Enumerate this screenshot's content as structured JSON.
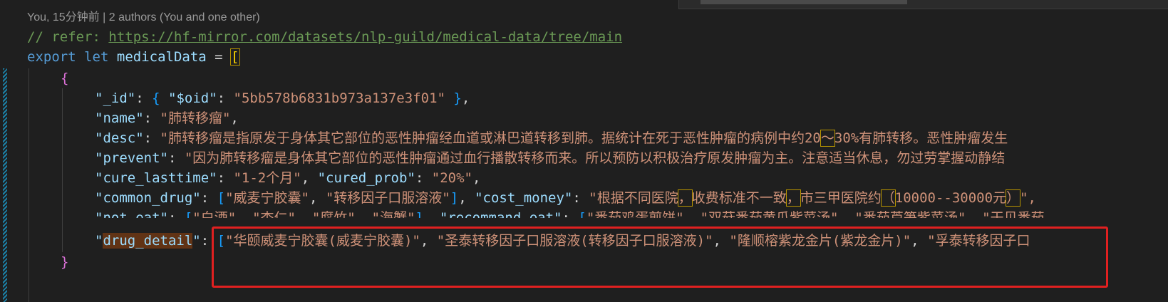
{
  "codelens": {
    "text": "You, 15分钟前 | 2 authors (You and one other)"
  },
  "code": {
    "comment_prefix": "// refer: ",
    "comment_url": "https://hf-mirror.com/datasets/nlp-guild/medical-data/tree/main",
    "export_kw": "export",
    "let_kw": "let",
    "var_name": "medicalData",
    "eq": " = ",
    "open_bracket": "[",
    "open_brace": "{",
    "close_brace": "}",
    "id_key": "\"_id\"",
    "oid_key": "\"$oid\"",
    "oid_val": "\"5bb578b6831b973a137e3f01\"",
    "name_key": "\"name\"",
    "name_val": "\"肺转移瘤\"",
    "desc_key": "\"desc\"",
    "desc_val": "\"肺转移瘤是指原发于身体其它部位的恶性肿瘤经血道或淋巴道转移到肺。据统计在死于恶性肿瘤的病例中约20",
    "desc_tilde": "～",
    "desc_val2": "30%有肺转移。恶性肿瘤发生",
    "prevent_key": "\"prevent\"",
    "prevent_val": "\"因为肺转移瘤是身体其它部位的恶性肿瘤通过血行播散转移而来。所以预防以积极治疗原发肿瘤为主。注意适当休息，勿过劳掌握动静结",
    "cure_key": "\"cure_lasttime\"",
    "cure_val": "\"1-2个月\"",
    "cured_key": "\"cured_prob\"",
    "cured_val": "\"20%\"",
    "drug_key": "\"common_drug\"",
    "drug_1": "\"威麦宁胶囊\"",
    "drug_2": "\"转移因子口服溶液\"",
    "cost_key": "\"cost_money\"",
    "cost_a": "\"根据不同医院",
    "cost_comma1": "，",
    "cost_b": "收费标准不一致",
    "cost_comma2": "，",
    "cost_c": "市三甲医院约",
    "cost_lp": "（",
    "cost_d": "10000--30000元",
    "cost_rp": "）",
    "cost_e": "\",",
    "noteat_key": "\"not_eat\"",
    "noteat_1": "\"白酒\"",
    "noteat_2": "\"杏仁\"",
    "noteat_3": "\"腐竹\"",
    "noteat_4": "\"海蟹\"",
    "rec_key": "\"recommand_eat\"",
    "rec_1": "\"番茄鸡蛋煎饼\"",
    "rec_2": "\"双菇番茄黄瓜紫菜汤\"",
    "rec_3": "\"番茄芦笋紫菜汤\"",
    "rec_4": "\"干贝番茄",
    "detail_q1": "\"",
    "detail_word": "drug_detail",
    "detail_q2": "\"",
    "detail_1": "\"华颐威麦宁胶囊(威麦宁胶囊)\"",
    "detail_2": "\"圣泰转移因子口服溶液(转移因子口服溶液)\"",
    "detail_3": "\"隆顺榕紫龙金片(紫龙金片)\"",
    "detail_4": "\"孚泰转移因子口"
  },
  "colors": {
    "background": "#1f1f1f",
    "keyword": "#569cd6",
    "string": "#ce9178",
    "property": "#9cdcfe",
    "comment": "#6a9955",
    "highlight_box": "#e02020"
  }
}
